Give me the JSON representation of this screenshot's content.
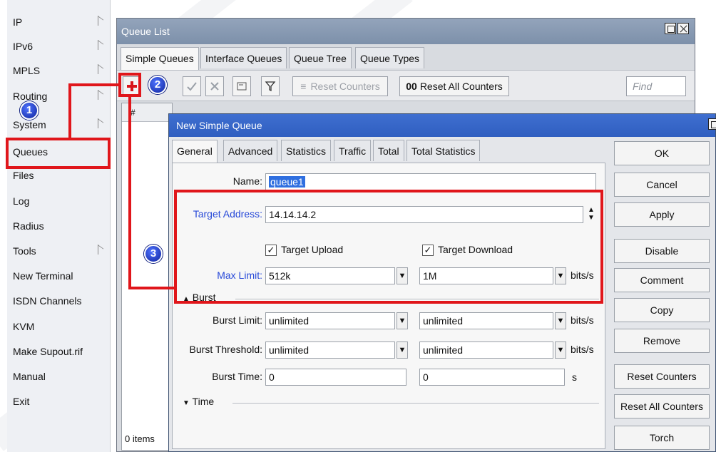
{
  "side_menu": {
    "items": [
      {
        "label": "IP",
        "submenu": true
      },
      {
        "label": "IPv6",
        "submenu": true
      },
      {
        "label": "MPLS",
        "submenu": true
      },
      {
        "label": "Routing",
        "submenu": true
      },
      {
        "label": "System",
        "submenu": true
      },
      {
        "label": "Queues",
        "submenu": false
      },
      {
        "label": "Files",
        "submenu": false
      },
      {
        "label": "Log",
        "submenu": false
      },
      {
        "label": "Radius",
        "submenu": false
      },
      {
        "label": "Tools",
        "submenu": true
      },
      {
        "label": "New Terminal",
        "submenu": false
      },
      {
        "label": "ISDN Channels",
        "submenu": false
      },
      {
        "label": "KVM",
        "submenu": false
      },
      {
        "label": "Make Supout.rif",
        "submenu": false
      },
      {
        "label": "Manual",
        "submenu": false
      },
      {
        "label": "Exit",
        "submenu": false
      }
    ]
  },
  "queue_list": {
    "title": "Queue List",
    "tabs": [
      "Simple Queues",
      "Interface Queues",
      "Queue Tree",
      "Queue Types"
    ],
    "active_tab": "Simple Queues",
    "toolbar": {
      "add_icon": "plus-icon",
      "enable_icon": "check-icon",
      "disable_icon": "x-icon",
      "comment_icon": "note-icon",
      "filter_icon": "filter-icon",
      "reset_counters": "Reset Counters",
      "reset_all_prefix": "00",
      "reset_all_counters": "Reset All Counters",
      "find_placeholder": "Find"
    },
    "column_header": "#",
    "items_count": "0 items"
  },
  "dialog": {
    "title": "New Simple Queue",
    "tabs": [
      "General",
      "Advanced",
      "Statistics",
      "Traffic",
      "Total",
      "Total Statistics"
    ],
    "active_tab": "General",
    "fields": {
      "name_label": "Name:",
      "name_value": "queue1",
      "target_address_label": "Target Address:",
      "target_address_value": "14.14.14.2",
      "target_upload_label": "Target Upload",
      "target_upload_checked": true,
      "target_download_label": "Target Download",
      "target_download_checked": true,
      "max_limit_label": "Max Limit:",
      "max_limit_upload": "512k",
      "max_limit_download": "1M",
      "bits_unit": "bits/s",
      "burst_section": "Burst",
      "burst_limit_label": "Burst Limit:",
      "burst_limit_upload": "unlimited",
      "burst_limit_download": "unlimited",
      "burst_threshold_label": "Burst Threshold:",
      "burst_threshold_upload": "unlimited",
      "burst_threshold_download": "unlimited",
      "burst_time_label": "Burst Time:",
      "burst_time_upload": "0",
      "burst_time_download": "0",
      "seconds_unit": "s",
      "time_section": "Time"
    },
    "buttons": [
      "OK",
      "Cancel",
      "Apply",
      "Disable",
      "Comment",
      "Copy",
      "Remove",
      "Reset Counters",
      "Reset All Counters",
      "Torch"
    ]
  },
  "annotations": {
    "step1": "1",
    "step2": "2",
    "step3": "3",
    "highlight_color": "#e0161b",
    "badge_color": "#1b33c8"
  }
}
